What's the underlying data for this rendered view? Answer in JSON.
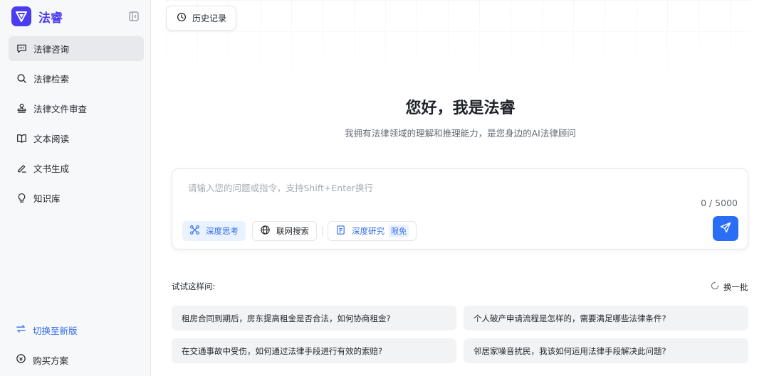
{
  "brand": {
    "name": "法睿",
    "accent_color": "#4b3cf0"
  },
  "sidebar": {
    "items": [
      {
        "label": "法律咨询",
        "icon": "chat-bubble-icon",
        "active": true
      },
      {
        "label": "法律检索",
        "icon": "search-icon",
        "active": false
      },
      {
        "label": "法律文件审查",
        "icon": "stamp-icon",
        "active": false
      },
      {
        "label": "文本阅读",
        "icon": "book-open-icon",
        "active": false
      },
      {
        "label": "文书生成",
        "icon": "pen-icon",
        "active": false
      },
      {
        "label": "知识库",
        "icon": "lightbulb-icon",
        "active": false
      }
    ],
    "switch_label": "切换至新版",
    "purchase_label": "购买方案"
  },
  "header": {
    "history_label": "历史记录"
  },
  "hero": {
    "title": "您好，我是法睿",
    "subtitle": "我拥有法律领域的理解和推理能力，是您身边的AI法律顾问"
  },
  "input": {
    "placeholder": "请输入您的问题或指令，支持Shift+Enter换行",
    "value": "",
    "counter": "0 / 5000",
    "chips": {
      "deep_think": "深度思考",
      "web_search": "联网搜索",
      "deep_research": "深度研究",
      "deep_research_badge": "限免"
    },
    "send_color": "#2b6ef6"
  },
  "suggestions": {
    "label": "试试这样问:",
    "refresh_label": "换一批",
    "items": [
      "租房合同到期后，房东提高租金是否合法，如何协商租金?",
      "个人破产申请流程是怎样的，需要满足哪些法律条件?",
      "在交通事故中受伤，如何通过法律手段进行有效的索赔?",
      "邻居家噪音扰民，我该如何运用法律手段解决此问题?"
    ]
  }
}
